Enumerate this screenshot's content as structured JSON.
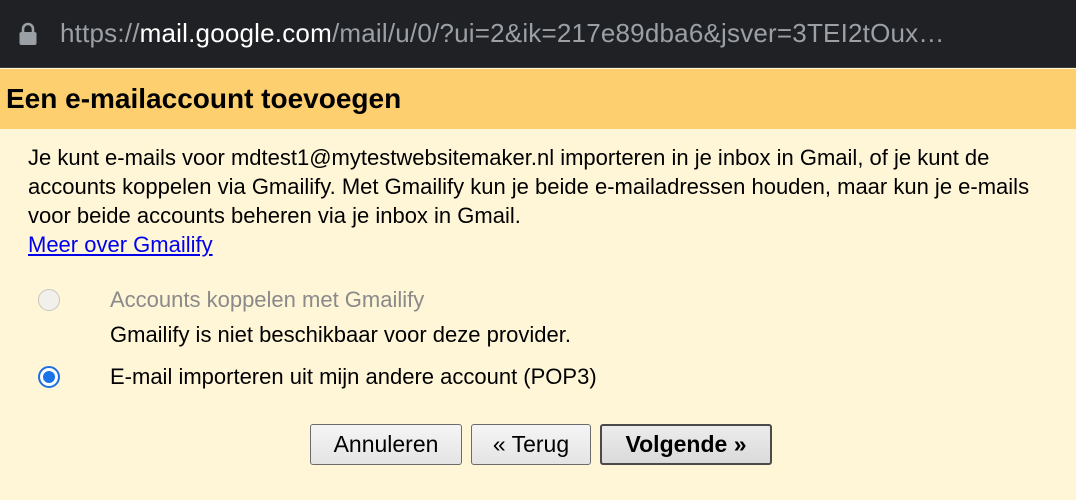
{
  "browser": {
    "url_scheme": "https://",
    "url_host": "mail.google.com",
    "url_path": "/mail/u/0/?ui=2&ik=217e89dba6&jsver=3TEI2tOux…",
    "lock_icon": "lock-icon"
  },
  "dialog": {
    "title": "Een e-mailaccount toevoegen",
    "intro": "Je kunt e-mails voor mdtest1@mytestwebsitemaker.nl importeren in je inbox in Gmail, of je kunt de accounts koppelen via Gmailify. Met Gmailify kun je beide e-mailadressen houden, maar kun je e-mails voor beide accounts beheren via je inbox in Gmail.",
    "learn_more": "Meer over Gmailify",
    "options": [
      {
        "label": "Accounts koppelen met Gmailify",
        "disabled": true,
        "checked": false,
        "note": "Gmailify is niet beschikbaar voor deze provider."
      },
      {
        "label": "E-mail importeren uit mijn andere account (POP3)",
        "disabled": false,
        "checked": true
      }
    ],
    "buttons": {
      "cancel": "Annuleren",
      "back": "« Terug",
      "next": "Volgende »"
    }
  },
  "colors": {
    "title_bar": "#fdcf6f",
    "background": "#fff6d8",
    "link": "#0000ee",
    "radio_selected": "#1a73e8"
  }
}
